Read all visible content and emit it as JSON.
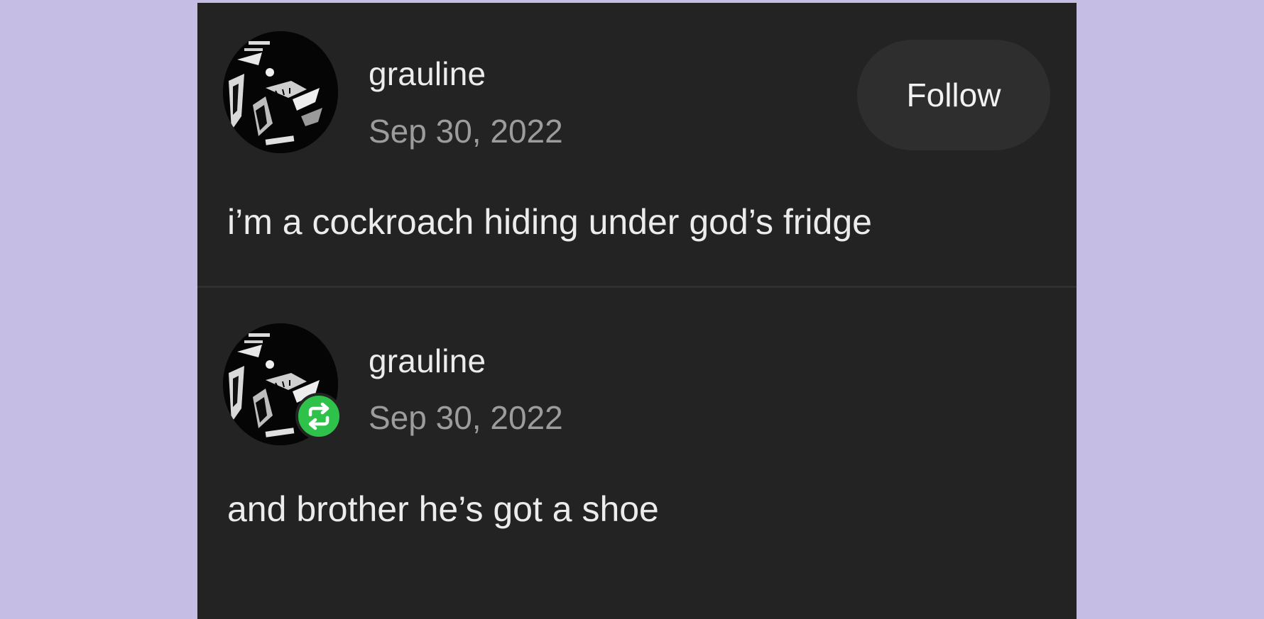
{
  "posts": [
    {
      "username": "grauline",
      "date": "Sep 30, 2022",
      "text": "i’m a cockroach hiding under god’s fridge",
      "follow_label": "Follow",
      "avatar_icon": "profile-avatar-image"
    },
    {
      "username": "grauline",
      "date": "Sep 30, 2022",
      "text": "and brother he’s got a shoe",
      "avatar_icon": "profile-avatar-image",
      "badge_icon": "reblog-icon"
    }
  ],
  "colors": {
    "page_background": "#c6bde4",
    "card_background": "#232323",
    "follow_button_background": "#2e2e2e",
    "reblog_badge": "#2fc24b",
    "primary_text": "#ececec",
    "secondary_text": "#9c9c9c"
  }
}
